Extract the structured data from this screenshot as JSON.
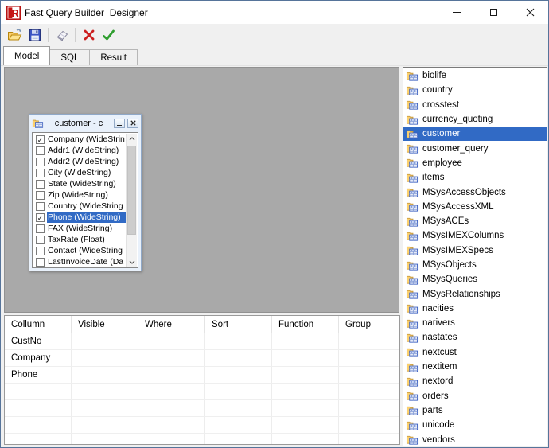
{
  "window": {
    "title": "Fast Query Builder  Designer",
    "icon": "fastreport-logo",
    "controls": [
      "minimize",
      "maximize",
      "close"
    ]
  },
  "toolbar": {
    "buttons": [
      {
        "name": "open-file",
        "icon": "folder-open-icon"
      },
      {
        "name": "save",
        "icon": "floppy-disk-icon"
      },
      {
        "name": "clear",
        "icon": "eraser-icon"
      },
      {
        "name": "cancel",
        "icon": "red-x-icon"
      },
      {
        "name": "ok",
        "icon": "green-check-icon"
      }
    ]
  },
  "tabs": [
    {
      "label": "Model",
      "active": true
    },
    {
      "label": "SQL",
      "active": false
    },
    {
      "label": "Result",
      "active": false
    }
  ],
  "field_window": {
    "title": "customer - c",
    "check_glyph": "✓",
    "fields": [
      {
        "label": "Company (WideStrin",
        "checked": true,
        "selected": false
      },
      {
        "label": "Addr1 (WideString)",
        "checked": false,
        "selected": false
      },
      {
        "label": "Addr2 (WideString)",
        "checked": false,
        "selected": false
      },
      {
        "label": "City (WideString)",
        "checked": false,
        "selected": false
      },
      {
        "label": "State (WideString)",
        "checked": false,
        "selected": false
      },
      {
        "label": "Zip (WideString)",
        "checked": false,
        "selected": false
      },
      {
        "label": "Country (WideString",
        "checked": false,
        "selected": false
      },
      {
        "label": "Phone (WideString)",
        "checked": true,
        "selected": true
      },
      {
        "label": "FAX (WideString)",
        "checked": false,
        "selected": false
      },
      {
        "label": "TaxRate (Float)",
        "checked": false,
        "selected": false
      },
      {
        "label": "Contact (WideString",
        "checked": false,
        "selected": false
      },
      {
        "label": "LastInvoiceDate (Da",
        "checked": false,
        "selected": false
      }
    ]
  },
  "tables_panel": {
    "selected_index": 4,
    "items": [
      "biolife",
      "country",
      "crosstest",
      "currency_quoting",
      "customer",
      "customer_query",
      "employee",
      "items",
      "MSysAccessObjects",
      "MSysAccessXML",
      "MSysACEs",
      "MSysIMEXColumns",
      "MSysIMEXSpecs",
      "MSysObjects",
      "MSysQueries",
      "MSysRelationships",
      "nacities",
      "narivers",
      "nastates",
      "nextcust",
      "nextitem",
      "nextord",
      "orders",
      "parts",
      "unicode",
      "vendors"
    ]
  },
  "grid": {
    "columns": [
      "Collumn",
      "Visible",
      "Where",
      "Sort",
      "Function",
      "Group"
    ],
    "rows": [
      "CustNo",
      "Company",
      "Phone"
    ]
  },
  "colors": {
    "selection": "#316AC5",
    "canvas_gray": "#a9a9a9",
    "cancel_red": "#cc2020",
    "ok_green": "#2f9e2f"
  }
}
